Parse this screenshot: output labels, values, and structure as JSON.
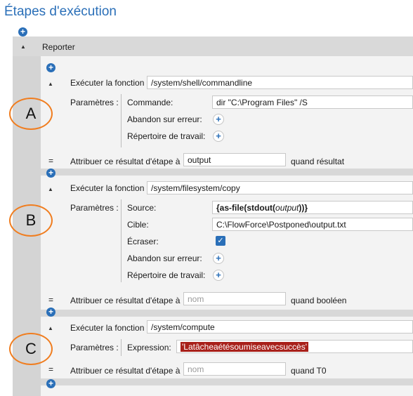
{
  "page": {
    "title": "Étapes d'exécution"
  },
  "reporter": {
    "label": "Reporter"
  },
  "annotations": [
    "A",
    "B",
    "C"
  ],
  "steps": [
    {
      "exec_label": "Exécuter la fonction",
      "function_path": "/system/shell/commandline",
      "params_label": "Paramètres :",
      "params": {
        "commande_label": "Commande:",
        "commande_value": "dir \"C:\\Program Files\" /S",
        "abandon_label": "Abandon sur erreur:",
        "repertoire_label": "Répertoire de travail:"
      },
      "assign_eq": "=",
      "assign_label": "Attribuer ce résultat d'étape à",
      "assign_value": "output",
      "assign_suffix": "quand résultat"
    },
    {
      "exec_label": "Exécuter la fonction",
      "function_path": "/system/filesystem/copy",
      "params_label": "Paramètres :",
      "params": {
        "source_label": "Source:",
        "source_expr": {
          "open": "{",
          "f1": "as-file",
          "p1": "(",
          "f2": "stdout",
          "p2": "(",
          "arg": "output",
          "close": "))}"
        },
        "cible_label": "Cible:",
        "cible_value": "C:\\FlowForce\\Postponed\\output.txt",
        "ecraser_label": "Écraser:",
        "ecraser_checked": true,
        "abandon_label": "Abandon sur erreur:",
        "repertoire_label": "Répertoire de travail:"
      },
      "assign_eq": "=",
      "assign_label": "Attribuer ce résultat d'étape à",
      "assign_placeholder": "nom",
      "assign_suffix": "quand booléen"
    },
    {
      "exec_label": "Exécuter la fonction",
      "function_path": "/system/compute",
      "params_label": "Paramètres :",
      "params": {
        "expression_label": "Expression:",
        "expression_value": "'Latâcheaétésoumiseavecsuccès'"
      },
      "assign_eq": "=",
      "assign_label": "Attribuer ce résultat d'étape à",
      "assign_placeholder": "nom",
      "assign_suffix": "quand T0"
    }
  ],
  "icons": {
    "add": "+",
    "collapse": "▲",
    "checkmark": "✓"
  },
  "colors": {
    "accent": "#2a6fb8",
    "annotation": "#f07d1f",
    "expression_highlight": "#a8201a"
  }
}
